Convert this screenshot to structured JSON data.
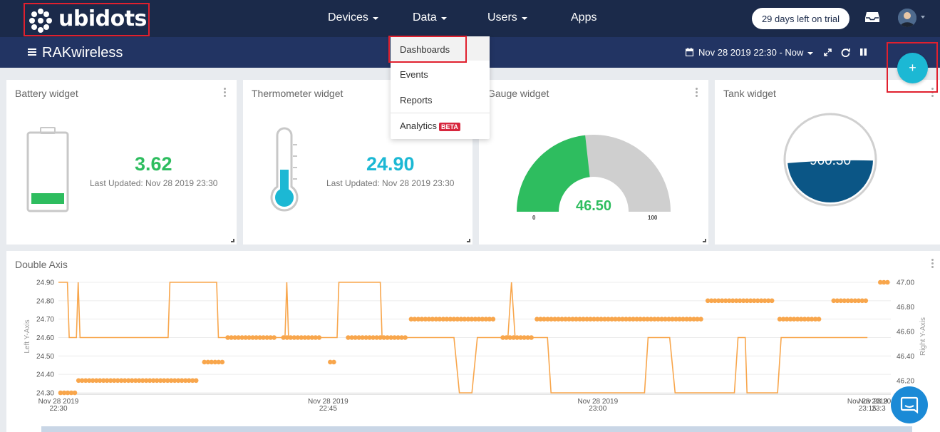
{
  "nav": {
    "logo_text": "ubidots",
    "items": [
      {
        "label": "Devices",
        "has_caret": true
      },
      {
        "label": "Data",
        "has_caret": true
      },
      {
        "label": "Users",
        "has_caret": true
      },
      {
        "label": "Apps",
        "has_caret": false
      }
    ],
    "trial_label": "29 days left on trial",
    "inbox_icon": "inbox-icon",
    "avatar_icon": "user-avatar"
  },
  "dashboard": {
    "title": "RAKwireless",
    "date_range": "Nov 28 2019 22:30 - Now",
    "controls": [
      "calendar-icon",
      "expand-icon",
      "refresh-icon",
      "pause-icon"
    ]
  },
  "data_menu": {
    "items": [
      {
        "label": "Dashboards",
        "highlighted": true
      },
      {
        "label": "Events"
      },
      {
        "label": "Reports"
      },
      {
        "label": "Analytics",
        "badge": "BETA"
      }
    ]
  },
  "widgets": {
    "battery": {
      "title": "Battery widget",
      "value": "3.62",
      "last_updated": "Last Updated: Nov 28 2019 23:30",
      "level": 0.25
    },
    "thermometer": {
      "title": "Thermometer widget",
      "value": "24.90",
      "last_updated": "Last Updated: Nov 28 2019 23:30",
      "level": 0.35
    },
    "gauge": {
      "title": "Gauge widget",
      "value": "46.50",
      "min": "0",
      "max": "100",
      "fraction": 0.465
    },
    "tank": {
      "title": "Tank widget",
      "value": "960.30",
      "level": 0.48
    }
  },
  "colors": {
    "navy": "#1b2a4a",
    "bar": "#223463",
    "green": "#2ebd5f",
    "cyan": "#1cb8d4",
    "tank": "#0b5686",
    "orange": "#f8a64c",
    "red": "#e0202e"
  },
  "chart_data": {
    "type": "line",
    "title": "Double Axis",
    "ylabel": "Left Y-Axis",
    "y2label": "Right Y-Axis",
    "left_ticks": [
      "24.90",
      "24.80",
      "24.70",
      "24.60",
      "24.50",
      "24.40",
      "24.30"
    ],
    "right_ticks": [
      "47.00",
      "46.80",
      "46.60",
      "46.40",
      "46.20"
    ],
    "x_ticks": [
      {
        "date": "Nov 28 2019",
        "time": "22:30"
      },
      {
        "date": "Nov 28 2019",
        "time": "22:45"
      },
      {
        "date": "Nov 28 2019",
        "time": "23:00"
      },
      {
        "date": "Nov 28 2019",
        "time": "23:15"
      },
      {
        "date": "Nov 28 2019",
        "time": "23:3"
      }
    ],
    "ylim_left": [
      24.3,
      24.9
    ],
    "ylim_right": [
      46.1,
      47.0
    ],
    "series": [
      {
        "kind": "line",
        "axis": "left",
        "points": [
          [
            0,
            24.9
          ],
          [
            0.5,
            24.9
          ],
          [
            0.6,
            24.6
          ],
          [
            1.0,
            24.6
          ],
          [
            1.1,
            24.9
          ],
          [
            1.2,
            24.6
          ],
          [
            6.1,
            24.6
          ],
          [
            6.2,
            24.9
          ],
          [
            8.8,
            24.9
          ],
          [
            8.9,
            24.6
          ],
          [
            12.6,
            24.6
          ],
          [
            12.7,
            24.9
          ],
          [
            12.8,
            24.6
          ],
          [
            15.5,
            24.6
          ],
          [
            15.6,
            24.9
          ],
          [
            17.9,
            24.9
          ],
          [
            18.0,
            24.6
          ],
          [
            22.0,
            24.6
          ],
          [
            22.3,
            24.3
          ],
          [
            23.0,
            24.3
          ],
          [
            23.3,
            24.6
          ],
          [
            25.0,
            24.6
          ],
          [
            25.2,
            24.9
          ],
          [
            25.4,
            24.6
          ],
          [
            27.2,
            24.6
          ],
          [
            27.4,
            24.3
          ],
          [
            32.6,
            24.3
          ],
          [
            32.8,
            24.6
          ],
          [
            34.0,
            24.6
          ],
          [
            34.3,
            24.3
          ],
          [
            37.6,
            24.3
          ],
          [
            37.8,
            24.6
          ],
          [
            38.2,
            24.6
          ],
          [
            38.3,
            24.3
          ],
          [
            40.0,
            24.3
          ],
          [
            40.2,
            24.6
          ],
          [
            45.0,
            24.6
          ]
        ]
      },
      {
        "kind": "dots",
        "axis": "right",
        "runs": [
          {
            "x0": 0,
            "x1": 1.0,
            "y": 46.1
          },
          {
            "x0": 1.0,
            "x1": 7.8,
            "y": 46.2
          },
          {
            "x0": 8.0,
            "x1": 9.3,
            "y": 46.35
          },
          {
            "x0": 9.3,
            "x1": 12.2,
            "y": 46.55
          },
          {
            "x0": 12.4,
            "x1": 14.7,
            "y": 46.55
          },
          {
            "x0": 15.0,
            "x1": 15.5,
            "y": 46.35
          },
          {
            "x0": 16.0,
            "x1": 19.4,
            "y": 46.55
          },
          {
            "x0": 19.5,
            "x1": 24.4,
            "y": 46.7
          },
          {
            "x0": 24.6,
            "x1": 26.4,
            "y": 46.55
          },
          {
            "x0": 26.5,
            "x1": 35.9,
            "y": 46.7
          },
          {
            "x0": 36.0,
            "x1": 39.9,
            "y": 46.85
          },
          {
            "x0": 40.0,
            "x1": 42.5,
            "y": 46.7
          },
          {
            "x0": 43.0,
            "x1": 45.0,
            "y": 46.85
          },
          {
            "x0": 45.6,
            "x1": 46.2,
            "y": 47.0
          }
        ]
      }
    ],
    "x_domain": [
      0,
      46.3
    ]
  }
}
